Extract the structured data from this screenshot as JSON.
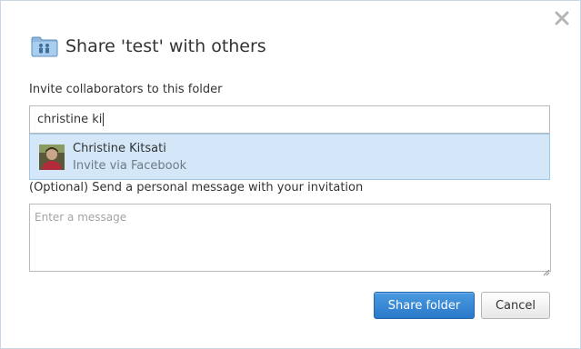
{
  "dialog": {
    "title": "Share 'test' with others",
    "invite_label": "Invite collaborators to this folder",
    "invite_value": "christine ki",
    "suggestion": {
      "name": "Christine Kitsati",
      "subtitle": "Invite via Facebook"
    },
    "optional_label": "(Optional) Send a personal message with your invitation",
    "message_placeholder": "Enter a message",
    "buttons": {
      "share_label": "Share folder",
      "cancel_label": "Cancel"
    }
  },
  "icons": {
    "close": "close-icon",
    "folder": "shared-folder-icon",
    "avatar": "avatar"
  },
  "colors": {
    "primary_button": "#2a78c9",
    "suggestion_highlight": "#d3e7f8",
    "border": "#b9b9b9"
  }
}
